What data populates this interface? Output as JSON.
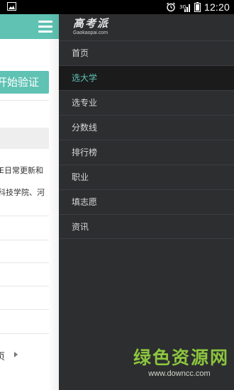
{
  "status_bar": {
    "time": "12:20",
    "left_icon": "image-notification-icon",
    "right_icons": [
      "alarm-icon",
      "signal-icon",
      "battery-icon"
    ]
  },
  "background_page": {
    "verify_button_label": "开始验证",
    "text_line_1": "E日常更新和",
    "text_line_2": "科技学院、河",
    "more_label": "页",
    "accent_color": "#5fc2b3"
  },
  "drawer": {
    "logo_title": "高考派",
    "logo_subtitle": "Gaokaopai.com",
    "items": [
      {
        "label": "首页",
        "active": false
      },
      {
        "label": "选大学",
        "active": true
      },
      {
        "label": "选专业",
        "active": false
      },
      {
        "label": "分数线",
        "active": false
      },
      {
        "label": "排行榜",
        "active": false
      },
      {
        "label": "职业",
        "active": false
      },
      {
        "label": "填志愿",
        "active": false
      },
      {
        "label": "资讯",
        "active": false
      }
    ],
    "background_color": "#2d2e30",
    "active_color": "#5fc2b3"
  },
  "watermark": {
    "text": "绿色资源网",
    "url": "www.downcc.com"
  }
}
